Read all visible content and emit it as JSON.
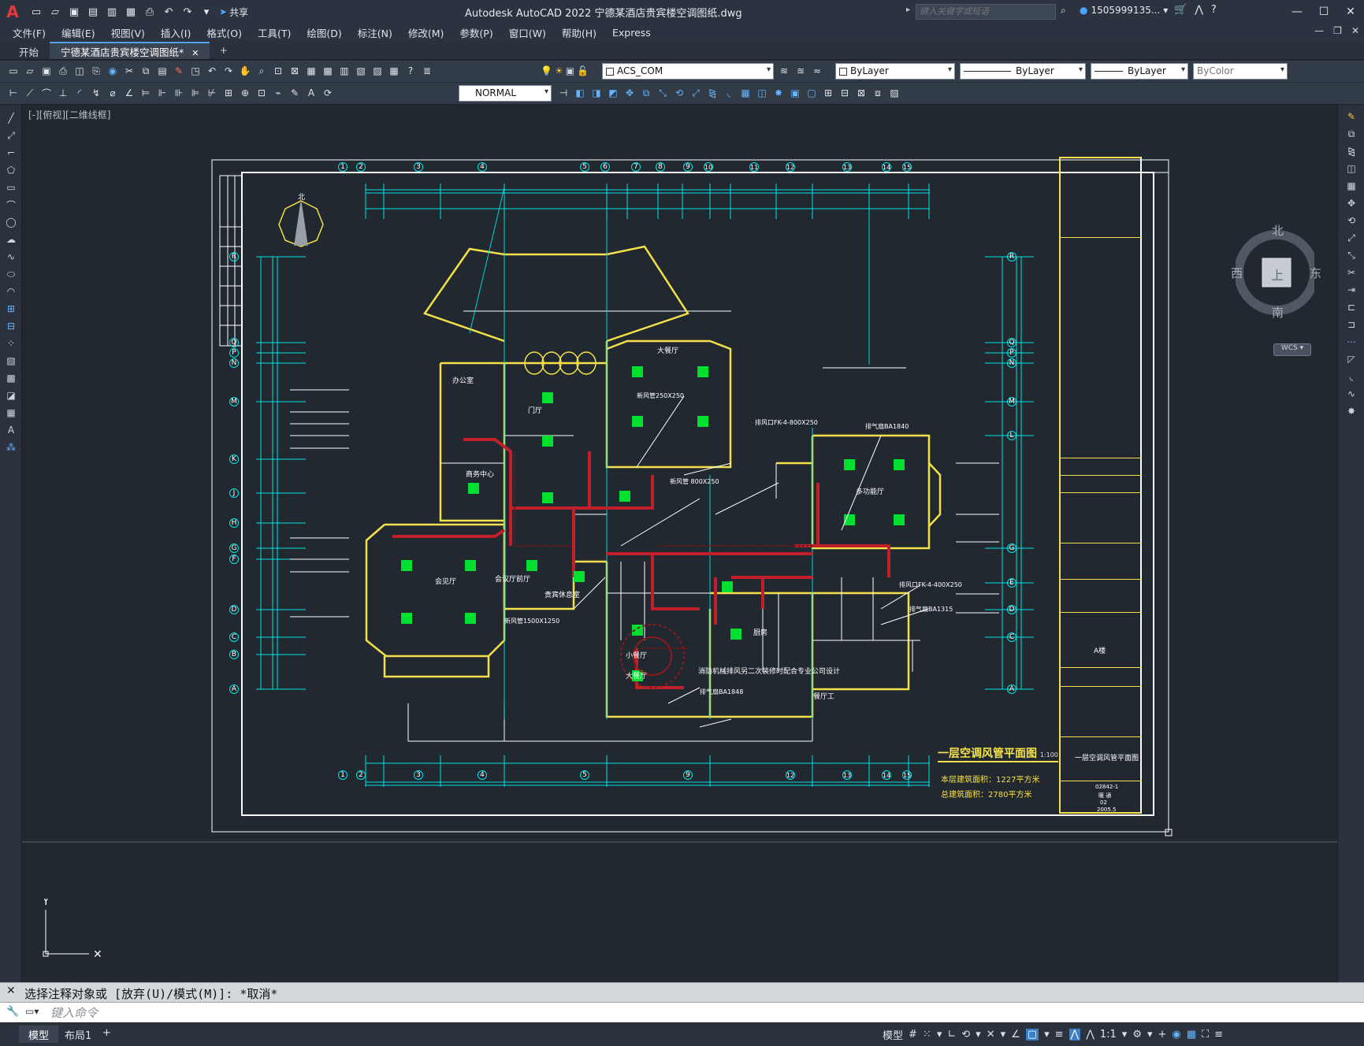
{
  "app": {
    "logo": "A",
    "title": "Autodesk AutoCAD 2022    宁德某酒店贵宾楼空调图纸.dwg",
    "share_label": "共享",
    "search_placeholder": "键入关键字或短语",
    "user": "1505999135...",
    "window_controls": [
      "—",
      "☐",
      "✕"
    ]
  },
  "menu": [
    "文件(F)",
    "编辑(E)",
    "视图(V)",
    "插入(I)",
    "格式(O)",
    "工具(T)",
    "绘图(D)",
    "标注(N)",
    "修改(M)",
    "参数(P)",
    "窗口(W)",
    "帮助(H)",
    "Express"
  ],
  "tabs": [
    {
      "label": "开始"
    },
    {
      "label": "宁德某酒店贵宾楼空调图纸*",
      "close": "✕"
    },
    {
      "label": "+"
    }
  ],
  "toolbar": {
    "layer": "ACS_COM",
    "color": "ByLayer",
    "linetype": "ByLayer",
    "lineweight": "ByLayer",
    "plotstyle": "ByColor",
    "dimstyle": "NORMAL"
  },
  "viewport": {
    "label": "[-][俯视][二维线框]",
    "compass": {
      "north": "北",
      "south": "南",
      "east": "东",
      "west": "西",
      "top": "上",
      "wcs": "WCS"
    }
  },
  "drawing": {
    "title": "一层空调风管平面图",
    "scale": "1:100",
    "area1": "本层建筑面积：1227平方米",
    "area2": "总建筑面积：2780平方米",
    "north_label": "北",
    "col_labels_top": [
      "1",
      "2",
      "3",
      "4",
      "5",
      "6",
      "7",
      "8",
      "9",
      "10",
      "11",
      "12",
      "13",
      "14",
      "15"
    ],
    "col_labels_bottom": [
      "1",
      "2",
      "3",
      "4",
      "5",
      "9",
      "12",
      "13",
      "14",
      "15"
    ],
    "row_labels_left": [
      "R",
      "Q",
      "P",
      "N",
      "M",
      "K",
      "J",
      "H",
      "G",
      "F",
      "D",
      "C",
      "B",
      "A"
    ],
    "row_labels_right": [
      "R",
      "Q",
      "P",
      "N",
      "M",
      "L",
      "G",
      "E",
      "D",
      "C",
      "A"
    ],
    "rooms": [
      "办公室",
      "门厅",
      "大餐厅",
      "商务中心",
      "会见厅",
      "贵宾休息室",
      "多功能厅",
      "厨房",
      "小餐厅",
      "大餐厅",
      "餐厅工",
      "会议厅前厅"
    ],
    "notes": [
      "排风口FK-4-800X250",
      "排气扇BA1840",
      "新风管 800X250",
      "新风管250X250",
      "消防机械排风另二次装修时配合专业公司设计",
      "排风口FK-4-400X250",
      "排气扇BA1315",
      "排气扇BA1848",
      "新风管1500X1250"
    ],
    "titleblock": {
      "project": "A楼",
      "drawing_name": "一层空调风管平面图",
      "drawing_no": "02842-1",
      "discipline": "暖 通",
      "sheet": "02",
      "date": "2005.5"
    }
  },
  "command": {
    "history": "选择注释对象或 [放弃(U)/模式(M)]: *取消*",
    "placeholder": "键入命令"
  },
  "status": {
    "layouts": [
      "模型",
      "布局1",
      "+"
    ],
    "model": "模型",
    "scale": "1:1"
  }
}
